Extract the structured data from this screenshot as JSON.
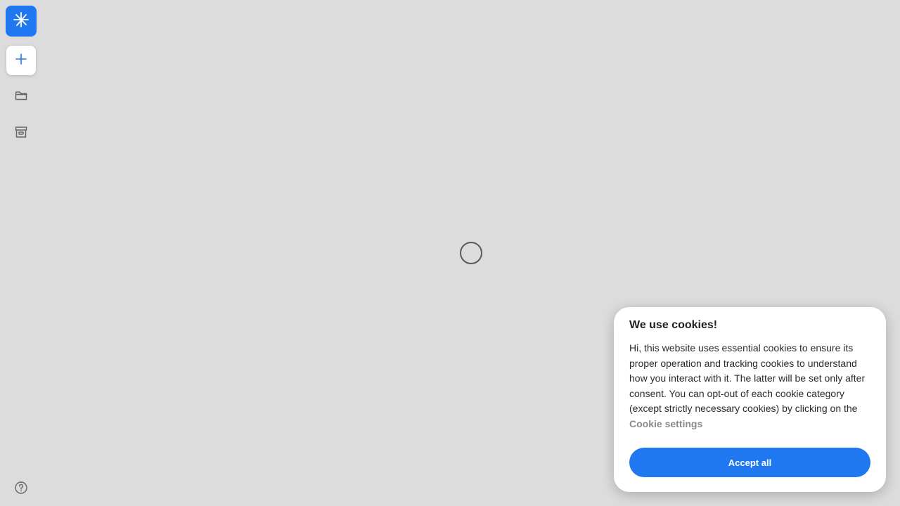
{
  "sidebar": {
    "logo_icon": "sparkle-icon",
    "new_icon": "plus-icon",
    "folder_icon": "folder-icon",
    "archive_icon": "archive-icon",
    "help_icon": "help-icon"
  },
  "main": {
    "loading_icon": "spinner-icon"
  },
  "cookie_banner": {
    "title": "We use cookies!",
    "text": "Hi, this website uses essential cookies to ensure its proper operation and tracking cookies to understand how you interact with it. The latter will be set only after consent. You can opt-out of each cookie category (except strictly necessary cookies) by clicking on the ",
    "link_label": "Cookie settings",
    "accept_label": "Accept all"
  },
  "colors": {
    "background": "#dcdcdc",
    "accent": "#1f78f0",
    "panel": "#ffffff"
  }
}
